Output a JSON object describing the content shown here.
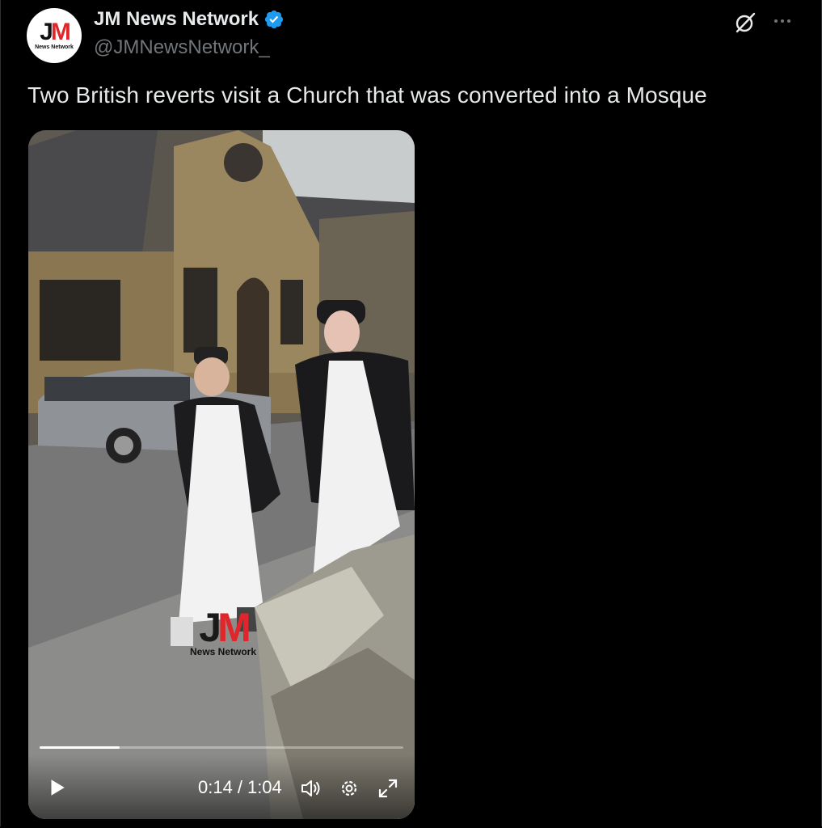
{
  "post": {
    "display_name": "JM News Network",
    "handle": "@JMNewsNetwork_",
    "text": "Two British reverts visit a Church that was converted into a Mosque",
    "avatar": {
      "letters_j": "J",
      "letters_m": "M",
      "subtitle": "News Network"
    },
    "icons": {
      "verified": "verified-badge-icon",
      "grok": "grok-icon",
      "more": "more-icon"
    },
    "colors": {
      "verified": "#1d9bf0",
      "brand_red": "#e0262b",
      "handle": "#71767b"
    }
  },
  "video": {
    "watermark": {
      "letters_j": "J",
      "letters_m": "M",
      "subtitle": "News Network"
    },
    "progress": 0.22,
    "current_time": "0:14",
    "separator": "/",
    "duration": "1:04",
    "icons": {
      "play": "play-icon",
      "volume": "volume-icon",
      "settings": "settings-icon",
      "fullscreen": "fullscreen-icon"
    }
  }
}
